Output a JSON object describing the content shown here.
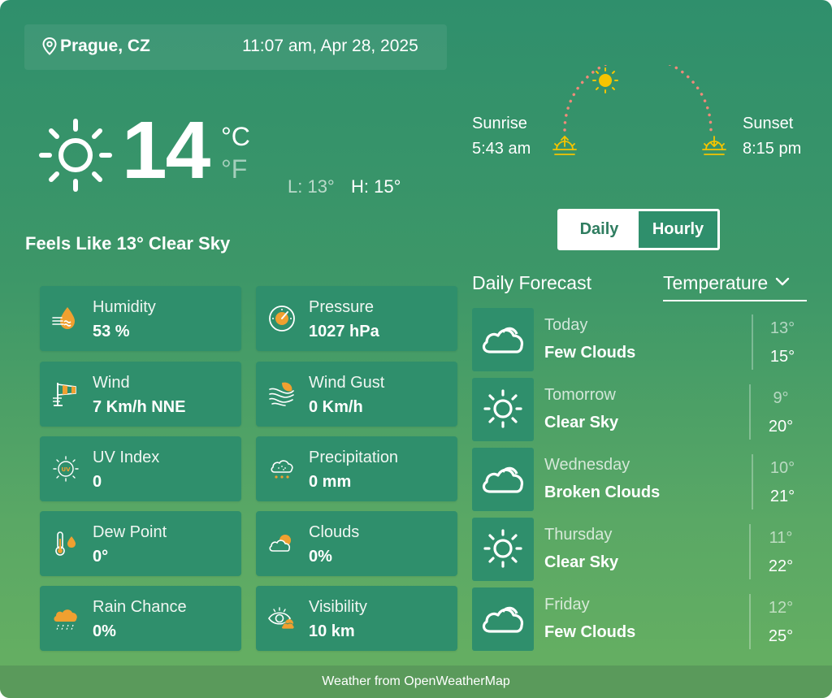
{
  "location": {
    "name": "Prague, CZ",
    "icon": "map-pin-icon"
  },
  "datetime": "11:07 am, Apr 28, 2025",
  "current": {
    "temp": "14",
    "unit_c": "°C",
    "unit_f": "°F",
    "low": "L: 13°",
    "high": "H: 15°",
    "feels": "Feels Like 13° Clear Sky",
    "icon": "sun-icon"
  },
  "details": [
    {
      "label": "Humidity",
      "value": "53 %",
      "icon": "humidity-icon"
    },
    {
      "label": "Pressure",
      "value": "1027 hPa",
      "icon": "pressure-gauge-icon"
    },
    {
      "label": "Wind",
      "value": "7 Km/h NNE",
      "icon": "windsock-icon"
    },
    {
      "label": "Wind Gust",
      "value": "0 Km/h",
      "icon": "wind-gust-icon"
    },
    {
      "label": "UV Index",
      "value": "0",
      "icon": "uv-index-icon"
    },
    {
      "label": "Precipitation",
      "value": "0 mm",
      "icon": "precipitation-icon"
    },
    {
      "label": "Dew Point",
      "value": "0°",
      "icon": "thermometer-drop-icon"
    },
    {
      "label": "Clouds",
      "value": "0%",
      "icon": "cloud-sun-icon"
    },
    {
      "label": "Rain Chance",
      "value": "0%",
      "icon": "rain-cloud-icon"
    },
    {
      "label": "Visibility",
      "value": "10 km",
      "icon": "eye-icon"
    }
  ],
  "sun": {
    "sunrise_label": "Sunrise",
    "sunrise_time": "5:43 am",
    "sunset_label": "Sunset",
    "sunset_time": "8:15 pm",
    "accent": "#f5c400",
    "arc_color": "#f08a7a"
  },
  "toggle": {
    "daily": "Daily",
    "hourly": "Hourly",
    "active": "Daily"
  },
  "forecast": {
    "title": "Daily Forecast",
    "metric": "Temperature",
    "days": [
      {
        "day": "Today",
        "cond": "Few Clouds",
        "low": "13°",
        "high": "15°",
        "icon": "cloud-icon"
      },
      {
        "day": "Tomorrow",
        "cond": "Clear Sky",
        "low": "9°",
        "high": "20°",
        "icon": "sun-icon"
      },
      {
        "day": "Wednesday",
        "cond": "Broken Clouds",
        "low": "10°",
        "high": "21°",
        "icon": "broken-clouds-icon"
      },
      {
        "day": "Thursday",
        "cond": "Clear Sky",
        "low": "11°",
        "high": "22°",
        "icon": "sun-icon"
      },
      {
        "day": "Friday",
        "cond": "Few Clouds",
        "low": "12°",
        "high": "25°",
        "icon": "cloud-icon"
      }
    ]
  },
  "footer": "Weather from OpenWeatherMap",
  "colors": {
    "card": "#2f8f6c",
    "bg_top": "#2f8f6c",
    "bg_bottom": "#67b061",
    "orange": "#f0a030"
  }
}
